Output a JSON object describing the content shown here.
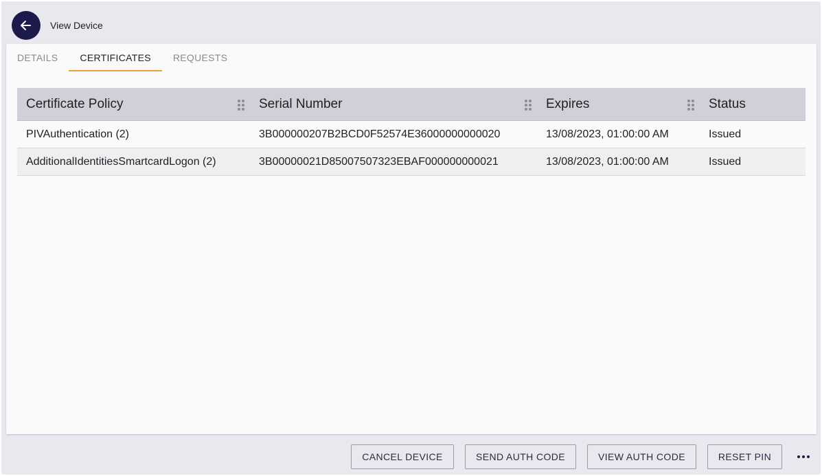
{
  "header": {
    "title": "View Device",
    "back_icon": "arrow-left-icon"
  },
  "tabs": [
    {
      "label": "DETAILS",
      "active": false
    },
    {
      "label": "CERTIFICATES",
      "active": true
    },
    {
      "label": "REQUESTS",
      "active": false
    }
  ],
  "grid": {
    "columns": [
      "Certificate Policy",
      "Serial Number",
      "Expires",
      "Status"
    ],
    "rows": [
      {
        "policy": "PIVAuthentication (2)",
        "serial": "3B000000207B2BCD0F52574E36000000000020",
        "expires": "13/08/2023, 01:00:00 AM",
        "status": "Issued"
      },
      {
        "policy": "AdditionalIdentitiesSmartcardLogon (2)",
        "serial": "3B00000021D85007507323EBAF000000000021",
        "expires": "13/08/2023, 01:00:00 AM",
        "status": "Issued"
      }
    ]
  },
  "actions": {
    "cancel_device": "CANCEL DEVICE",
    "send_auth_code": "SEND AUTH CODE",
    "view_auth_code": "VIEW AUTH CODE",
    "reset_pin": "RESET PIN",
    "more_icon": "more-horizontal-icon"
  },
  "colors": {
    "accent": "#e8a23a",
    "primary": "#1b1a4b",
    "header_bg": "#cfd0d8"
  }
}
